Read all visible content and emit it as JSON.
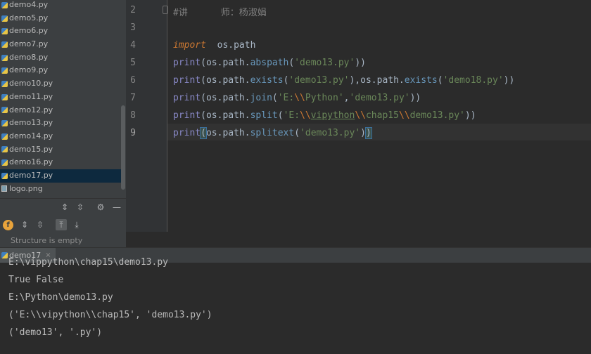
{
  "project_tree": {
    "files": [
      "demo4.py",
      "demo5.py",
      "demo6.py",
      "demo7.py",
      "demo8.py",
      "demo9.py",
      "demo10.py",
      "demo11.py",
      "demo12.py",
      "demo13.py",
      "demo14.py",
      "demo15.py",
      "demo16.py",
      "demo17.py",
      "logo.png"
    ],
    "selected_file": "demo17.py"
  },
  "structure_panel": {
    "empty_text": "Structure is empty"
  },
  "editor": {
    "line_numbers": [
      "2",
      "3",
      "4",
      "5",
      "6",
      "7",
      "8",
      "9"
    ],
    "comment": "#讲      师：杨淑娟",
    "line4": {
      "keyword": "import",
      "module": "  os.path"
    },
    "line5": {
      "print": "print",
      "obj": "(os.path.",
      "func": "abspath",
      "open": "(",
      "arg": "'demo13.py'",
      "close": "))"
    },
    "line6": {
      "print": "print",
      "obj": "(os.path.",
      "func": "exists",
      "open": "(",
      "arg": "'demo13.py'",
      "mid": "),os.path.",
      "func2": "exists",
      "open2": "(",
      "arg2": "'demo18.py'",
      "close": "))"
    },
    "line7": {
      "print": "print",
      "obj": "(os.path.",
      "func": "join",
      "open": "(",
      "arg_a": "'E:",
      "esc": "\\\\",
      "arg_b": "Python'",
      "comma": ",",
      "arg2": "'demo13.py'",
      "close": "))"
    },
    "line8": {
      "print": "print",
      "obj": "(os.path.",
      "func": "split",
      "open": "(",
      "arg_a": "'E:",
      "esc1": "\\\\",
      "arg_b": "vipython",
      "esc2": "\\\\",
      "arg_c": "chap15",
      "esc3": "\\\\",
      "arg_d": "demo13.py'",
      "close": "))"
    },
    "line9": {
      "print": "print",
      "paren": "(",
      "obj": "os.path.",
      "func": "splitext",
      "open": "(",
      "arg": "'demo13.py'",
      "close1": ")",
      "close2": ")"
    }
  },
  "run_panel": {
    "tab_label": "demo17",
    "close_glyph": "×",
    "output": [
      "E:\\vippython\\chap15\\demo13.py",
      "True False",
      "E:\\Python\\demo13.py",
      "('E:\\\\vipython\\\\chap15', 'demo13.py')",
      "('demo13', '.py')"
    ]
  }
}
